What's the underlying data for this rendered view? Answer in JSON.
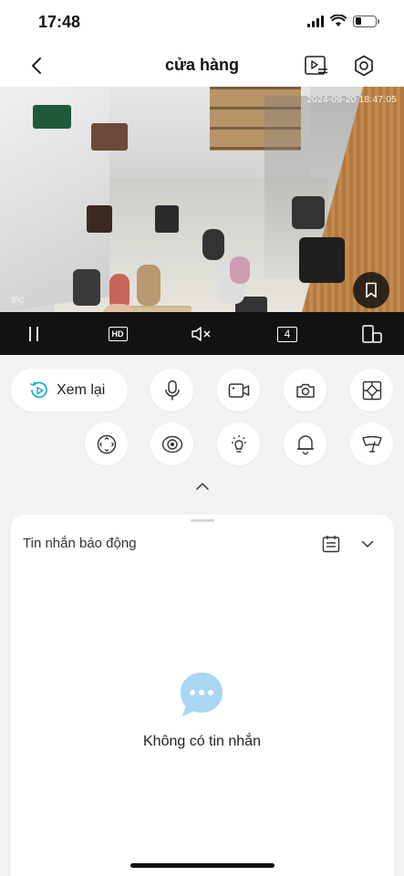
{
  "status_bar": {
    "time": "17:48"
  },
  "header": {
    "title": "cửa hàng",
    "back_icon": "chevron-left-icon",
    "playlist_icon": "playlist-icon",
    "settings_icon": "gear-icon"
  },
  "video": {
    "timestamp": "2024-09-20 18:47:05",
    "watermark": "IPC",
    "bookmark_icon": "bookmark-icon"
  },
  "controls": {
    "pause_icon": "pause-icon",
    "quality_label": "HD",
    "mute_icon": "speaker-muted-icon",
    "split_label": "4",
    "rotate_icon": "screen-rotate-icon"
  },
  "actions": {
    "replay_label": "Xem lại",
    "buttons_row1": [
      "microphone-icon",
      "video-record-icon",
      "camera-icon",
      "ptz-icon"
    ],
    "buttons_row2": [
      "joystick-icon",
      "eye-icon",
      "light-icon",
      "bell-icon",
      "wiper-icon"
    ]
  },
  "messages": {
    "title": "Tin nhắn báo động",
    "empty_text": "Không có tin nhắn"
  },
  "colors": {
    "accent": "#1aa7e0",
    "bubble": "#a8d6f3",
    "control_bar": "#121212",
    "background": "#f2f2f4"
  }
}
